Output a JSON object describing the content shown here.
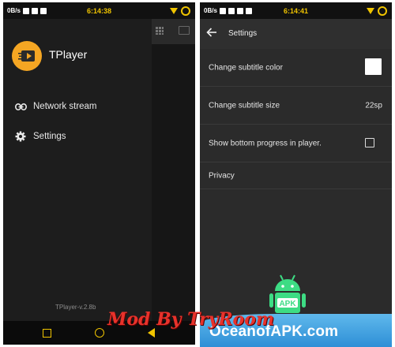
{
  "left_screen": {
    "status": {
      "speed": "0B/s",
      "time": "6:14:38"
    },
    "app_name": "TPlayer",
    "nav": [
      {
        "label": "Network stream",
        "icon": "link-icon"
      },
      {
        "label": "Settings",
        "icon": "gear-icon"
      }
    ],
    "version": "TPlayer-v.2.8b"
  },
  "right_screen": {
    "status": {
      "speed": "0B/s",
      "time": "6:14:41"
    },
    "title": "Settings",
    "rows": [
      {
        "label": "Change subtitle color",
        "control": "color-swatch",
        "swatch_color": "#ffffff"
      },
      {
        "label": "Change subtitle size",
        "value": "22sp"
      },
      {
        "label": "Show bottom progress in player.",
        "control": "checkbox",
        "checked": false
      },
      {
        "label": "Privacy"
      }
    ]
  },
  "overlay": {
    "watermark": "Mod By TryRoom",
    "brand": "OceanofAPK.com",
    "apk_label": "APK"
  },
  "colors": {
    "accent": "#f0c400",
    "logo": "#f5a623",
    "watermark": "#e8322b",
    "brand_bg": "#2e8fd6"
  }
}
